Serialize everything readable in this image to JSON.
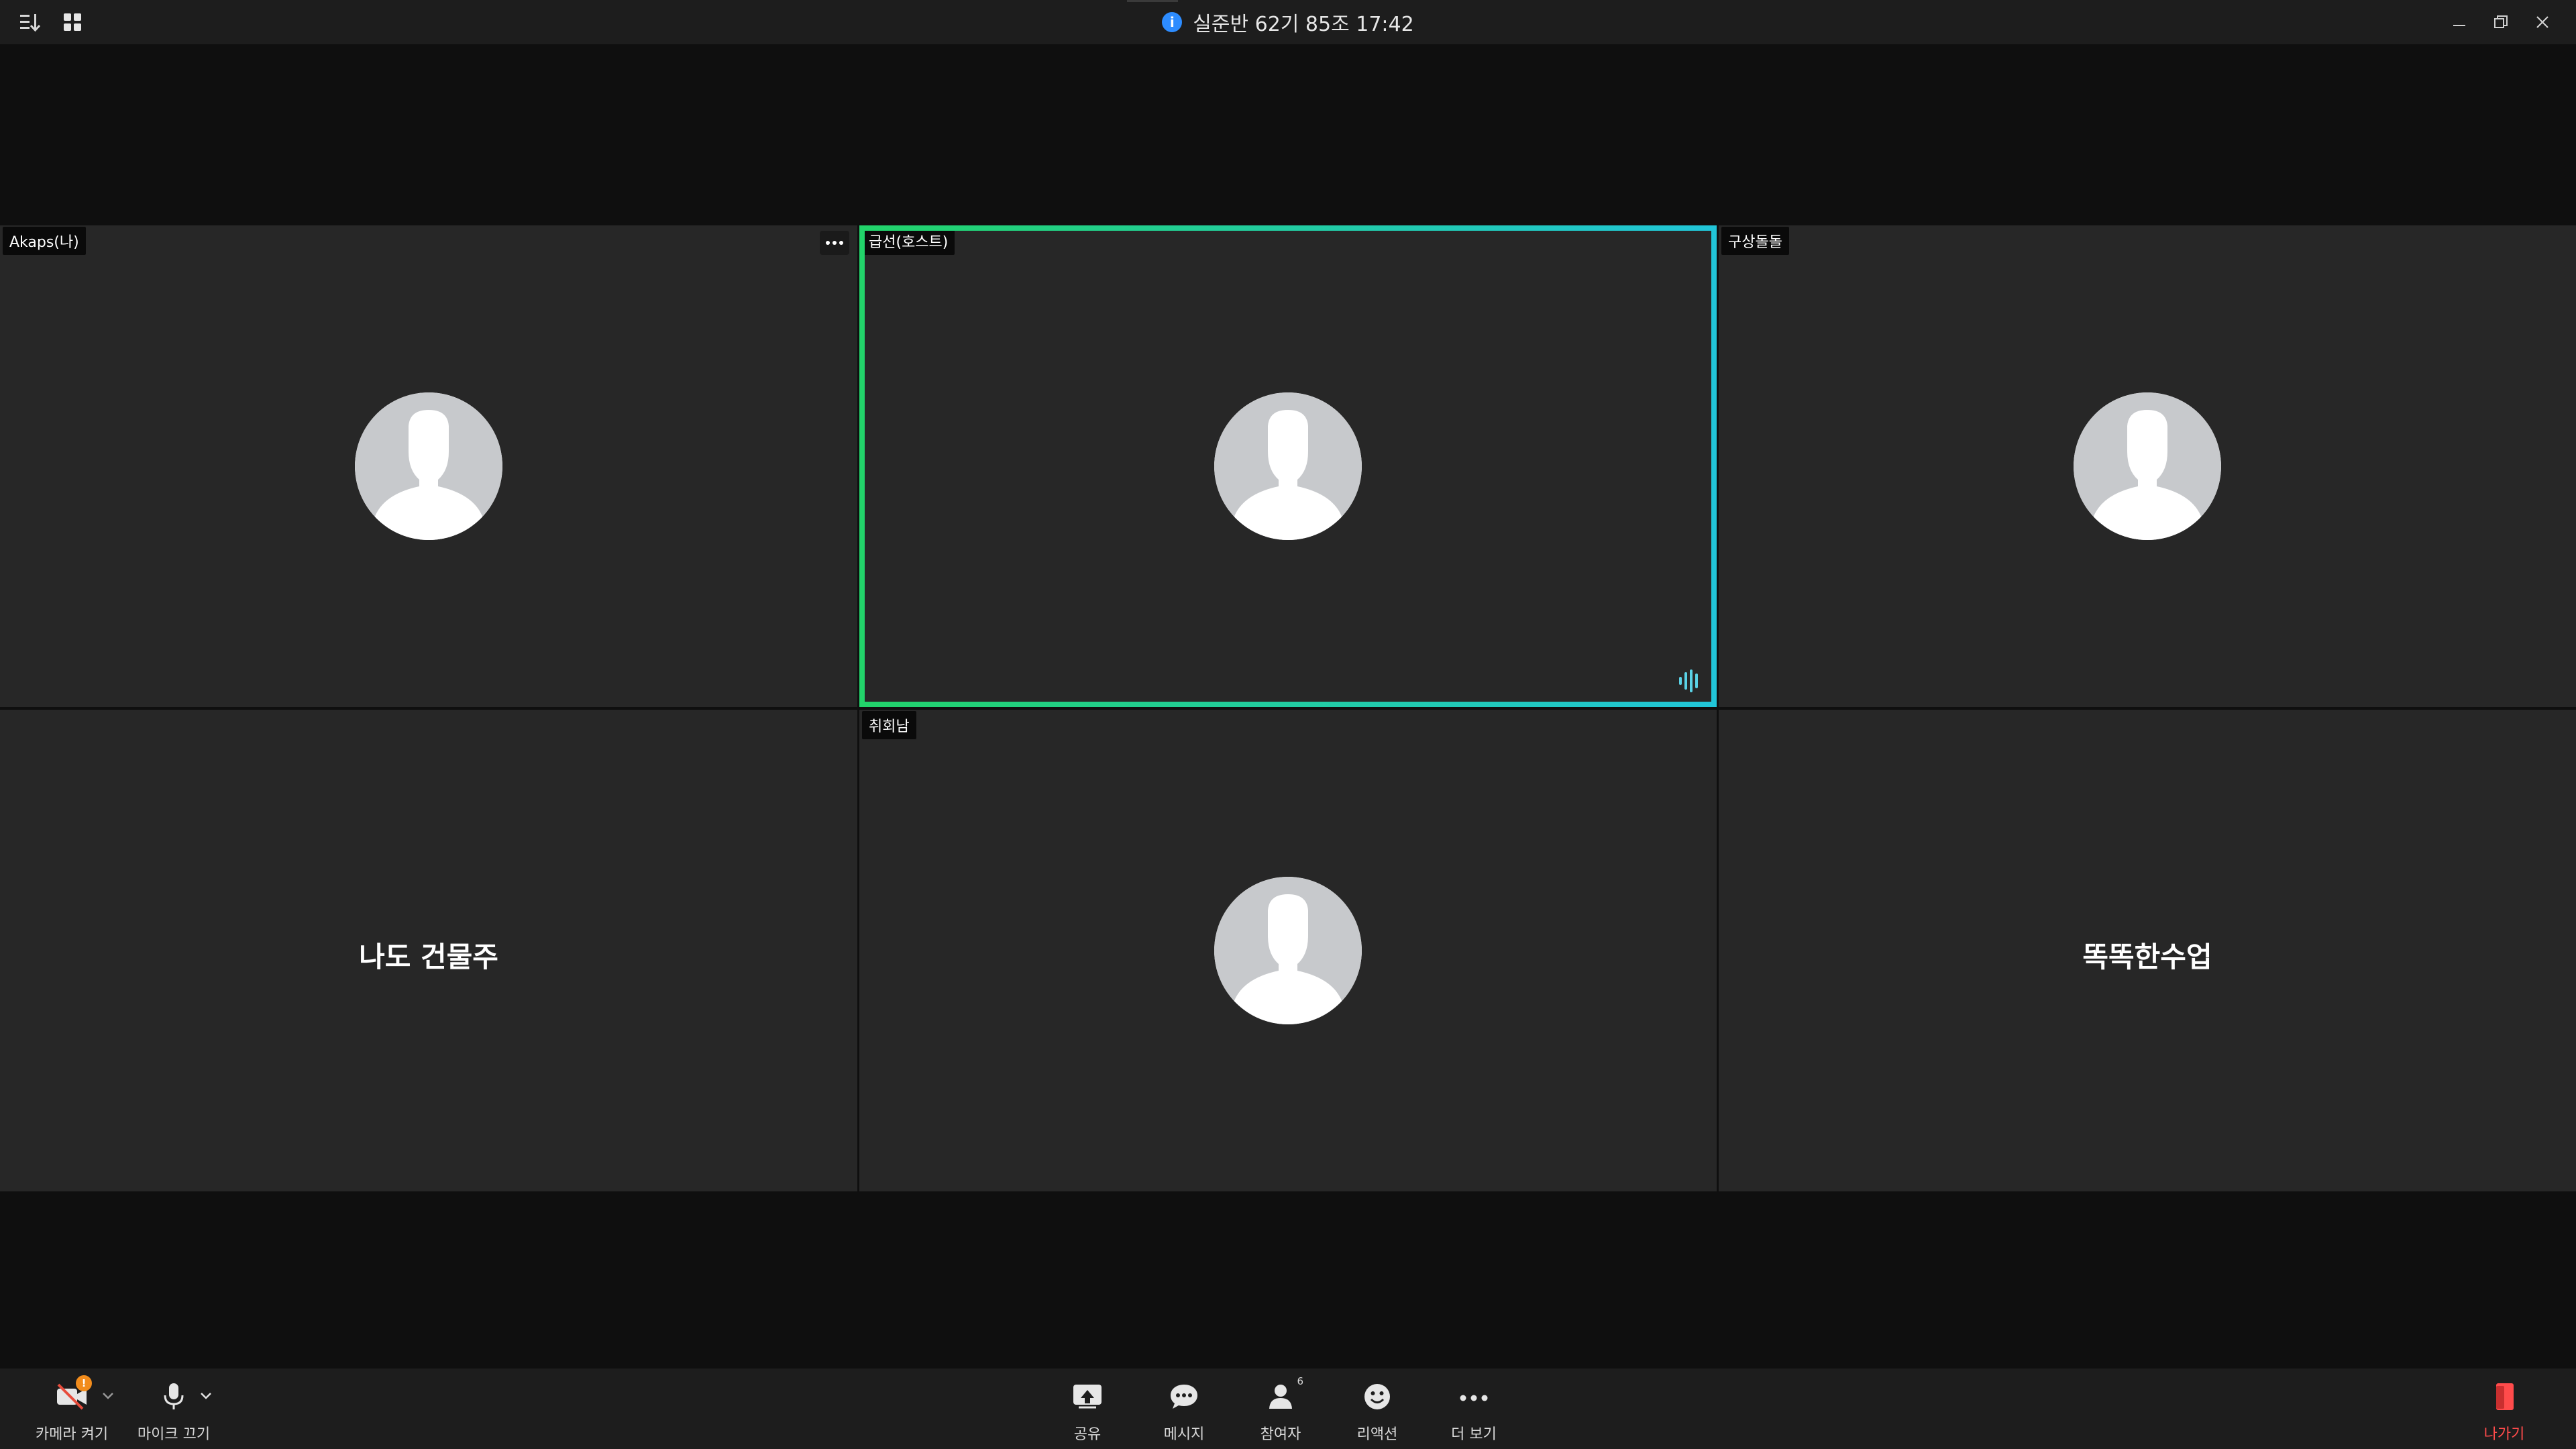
{
  "window": {
    "title": "실준반 62기 85조 17:42"
  },
  "participants": [
    {
      "name_tag": "Akaps(나)",
      "display_name": "",
      "has_avatar": true,
      "speaking": false,
      "show_more": true
    },
    {
      "name_tag": "급선(호스트)",
      "display_name": "",
      "has_avatar": true,
      "speaking": true,
      "show_more": false
    },
    {
      "name_tag": "구상돌돌",
      "display_name": "",
      "has_avatar": true,
      "speaking": false,
      "show_more": false
    },
    {
      "name_tag": "",
      "display_name": "나도 건물주",
      "has_avatar": false,
      "speaking": false,
      "show_more": false
    },
    {
      "name_tag": "취회남",
      "display_name": "",
      "has_avatar": true,
      "speaking": false,
      "show_more": false
    },
    {
      "name_tag": "",
      "display_name": "똑똑한수업",
      "has_avatar": false,
      "speaking": false,
      "show_more": false
    }
  ],
  "toolbar": {
    "camera_label": "카메라 켜기",
    "camera_badge": "!",
    "mic_label": "마이크 끄기",
    "share_label": "공유",
    "chat_label": "메시지",
    "participants_label": "참여자",
    "participants_count": "6",
    "reactions_label": "리액션",
    "more_label": "더 보기",
    "leave_label": "나가기"
  },
  "colors": {
    "accent_blue": "#2d8cff",
    "speaking_green": "#22d36a",
    "speaking_cyan": "#21c5d8",
    "leave_red": "#ff4b4b",
    "tile_bg": "#272727",
    "page_bg": "#0f0f0f"
  },
  "icons": {
    "title_left": [
      "sort-icon",
      "grid-view-icon"
    ],
    "title_right": [
      "minimize-icon",
      "restore-icon",
      "close-icon"
    ]
  }
}
